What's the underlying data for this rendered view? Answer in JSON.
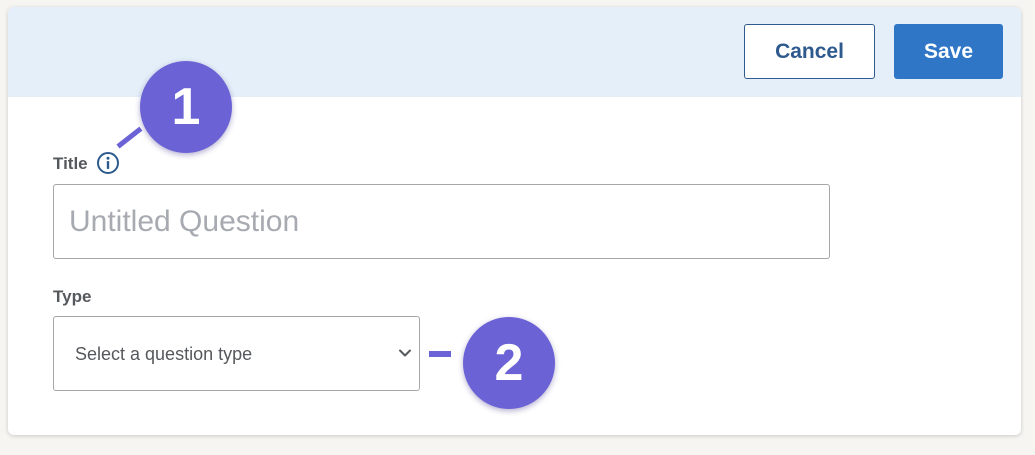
{
  "header": {
    "cancel_label": "Cancel",
    "save_label": "Save"
  },
  "form": {
    "title_label": "Title",
    "title_placeholder": "Untitled Question",
    "type_label": "Type",
    "type_selected": "Select a question type"
  },
  "callouts": [
    {
      "number": "1"
    },
    {
      "number": "2"
    }
  ],
  "icons": {
    "info": "info-icon",
    "chevron": "chevron-down-icon"
  },
  "colors": {
    "header_bg": "#e4eff9",
    "primary": "#3076c6",
    "cancel_text": "#2e5a8e",
    "callout": "#6b62d5"
  }
}
